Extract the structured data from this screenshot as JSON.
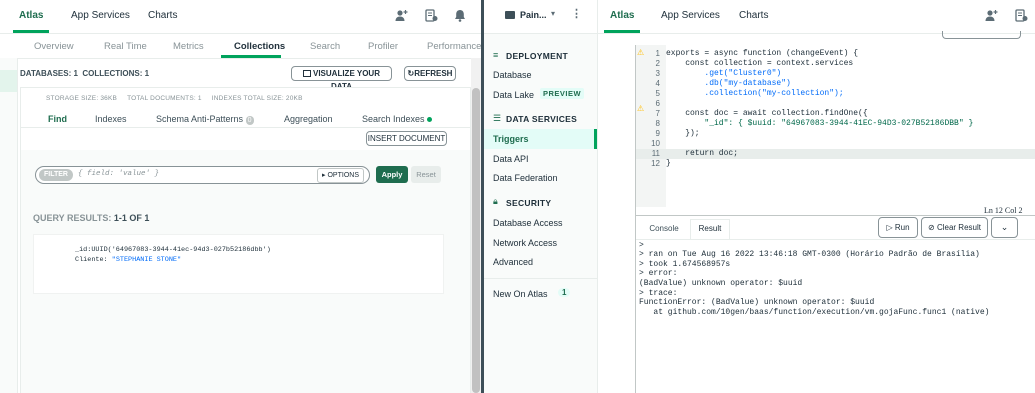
{
  "left": {
    "nav": {
      "atlas": "Atlas",
      "app_services": "App Services",
      "charts": "Charts"
    },
    "subtabs": [
      "Overview",
      "Real Time",
      "Metrics",
      "Collections",
      "Search",
      "Profiler",
      "Performance"
    ],
    "databases_label": "DATABASES: 1",
    "collections_label": "COLLECTIONS: 1",
    "visualize_label": "VISUALIZE YOUR DATA",
    "refresh_label": "REFRESH",
    "storage": "STORAGE SIZE: 36KB",
    "total_docs": "TOTAL DOCUMENTS: 1",
    "indexes_size": "INDEXES TOTAL SIZE: 20KB",
    "coltabs": {
      "find": "Find",
      "indexes": "Indexes",
      "schema": "Schema Anti-Patterns",
      "schema_count": "0",
      "aggregation": "Aggregation",
      "search_indexes": "Search Indexes"
    },
    "insert_label": "INSERT DOCUMENT",
    "filter_label": "FILTER",
    "filter_placeholder": "{ field: 'value' }",
    "options_label": "OPTIONS",
    "apply_label": "Apply",
    "reset_label": "Reset",
    "query_results_prefix": "QUERY RESULTS:",
    "query_results_count": "1-1 OF 1",
    "doc": {
      "id_key": "_id:",
      "id_val": "UUID('64967083-3944-41ec-94d3-027b52186dbb')",
      "cliente_key": "Cliente:",
      "cliente_val": "\"STEPHANIE STONE\""
    }
  },
  "right": {
    "project_label": "Pain...",
    "nav": {
      "atlas": "Atlas",
      "app_services": "App Services",
      "charts": "Charts"
    },
    "sidebar": {
      "deployment": "DEPLOYMENT",
      "database": "Database",
      "data_lake": "Data Lake",
      "preview": "PREVIEW",
      "data_services": "DATA SERVICES",
      "triggers": "Triggers",
      "data_api": "Data API",
      "data_federation": "Data Federation",
      "security": "SECURITY",
      "database_access": "Database Access",
      "network_access": "Network Access",
      "advanced": "Advanced",
      "new_on_atlas": "New On Atlas",
      "new_count": "1"
    },
    "code": [
      "exports = async function (changeEvent) {",
      "    const collection = context.services",
      "        .get(\"Cluster0\")",
      "        .db(\"my-database\")",
      "        .collection(\"my-collection\");",
      "",
      "    const doc = await collection.findOne({",
      "        \"_id\": { $uuid: \"64967083-3944-41EC-94D3-027B52186DBB\" }",
      "    });",
      "",
      "    return doc;",
      "}"
    ],
    "cursor_pos": "Ln 12 Col 2",
    "tabs": {
      "console": "Console",
      "result": "Result"
    },
    "run_label": "Run",
    "clear_label": "Clear Result",
    "output": [
      ">",
      "> ran on Tue Aug 16 2022 13:46:18 GMT-0300 (Horário Padrão de Brasília)",
      "> took 1.674568957s",
      "> error:",
      "(BadValue) unknown operator: $uuid",
      "> trace:",
      "FunctionError: (BadValue) unknown operator: $uuid",
      "   at github.com/10gen/baas/function/execution/vm.gojaFunc.func1 (native)"
    ]
  },
  "colors": {
    "green": "#00a35c",
    "dark_green": "#1f6d4f",
    "divider": "#3d4f58"
  }
}
